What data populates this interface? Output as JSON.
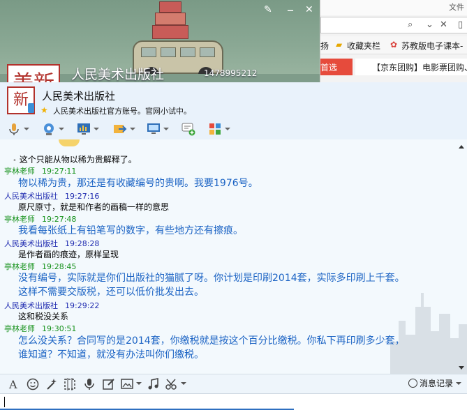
{
  "banner": {
    "name": "人民美术出版社",
    "id": "1478995212",
    "seal_text": "美新"
  },
  "browser": {
    "top_text": "文件",
    "favorites": [
      "收藏夹栏",
      "苏教版电子课本-"
    ],
    "fav_prefix": "扬",
    "tab1": "首选",
    "tab2": "【京东团购】电影票团购、"
  },
  "header": {
    "title": "人民美术出版社",
    "signature": "人民美术出版社官方账号。官网小试中。",
    "seal_text": "新"
  },
  "chat": {
    "messages": [
      {
        "kind": "body-b",
        "text": "这个只能从物以稀为贵解释了。"
      },
      {
        "kind": "head-a",
        "sender": "亭林老师",
        "time": "19:27:11"
      },
      {
        "kind": "body-a",
        "text": "物以稀为贵，那还是有收藏编号的贵啊。我要1976号。"
      },
      {
        "kind": "head-b",
        "sender": "人民美术出版社",
        "time": "19:27:16"
      },
      {
        "kind": "body-b",
        "text": "原尺原寸，就是和作者的画稿一样的意思"
      },
      {
        "kind": "head-a",
        "sender": "亭林老师",
        "time": "19:27:48"
      },
      {
        "kind": "body-a",
        "text": "我看每张纸上有铅笔写的数字，有些地方还有擦痕。"
      },
      {
        "kind": "head-b",
        "sender": "人民美术出版社",
        "time": "19:28:28"
      },
      {
        "kind": "body-b",
        "text": "是作者画的痕迹，原样呈现"
      },
      {
        "kind": "head-a",
        "sender": "亭林老师",
        "time": "19:28:45"
      },
      {
        "kind": "body-a",
        "text": "没有编号，实际就是你们出版社的猫腻了呀。你计划是印刷2014套，实际多印刷上千套。"
      },
      {
        "kind": "body-a",
        "text": "这样不需要交版税，还可以低价批发出去。"
      },
      {
        "kind": "head-b",
        "sender": "人民美术出版社",
        "time": "19:29:22"
      },
      {
        "kind": "body-b",
        "text": "这和税没关系"
      },
      {
        "kind": "head-a",
        "sender": "亭林老师",
        "time": "19:30:51"
      },
      {
        "kind": "body-a",
        "text": "怎么没关系？合同写的是2014套，你缴税就是按这个百分比缴税。你私下再印刷多少套，"
      },
      {
        "kind": "body-a",
        "text": "谁知道？不知道，就没有办法叫你们缴税。"
      }
    ]
  },
  "input_bar": {
    "history_label": "消息记录"
  },
  "colors": {
    "sender_friend": "#15911a",
    "sender_self": "#1f2bb0",
    "friend_text": "#1b63c4",
    "accent": "#2e6fc0"
  }
}
